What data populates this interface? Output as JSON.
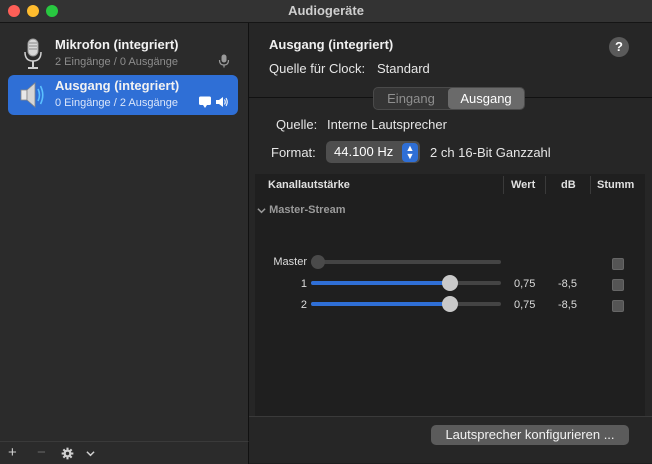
{
  "window": {
    "title": "Audiogeräte"
  },
  "sidebar": {
    "devices": [
      {
        "name": "Mikrofon (integriert)",
        "sub": "2 Eingänge / 0 Ausgänge",
        "icon": "microphone-icon",
        "badge_icon": "microphone-small-icon",
        "selected": false
      },
      {
        "name": "Ausgang (integriert)",
        "sub": "0 Eingänge / 2 Ausgänge",
        "icon": "speaker-icon",
        "badge_icon": "speaker-small-icon",
        "selected": true
      }
    ],
    "footer": {
      "add": "+",
      "remove": "−",
      "gear_icon": "gear-icon",
      "chevron_icon": "chevron-down-icon"
    }
  },
  "detail": {
    "title": "Ausgang (integriert)",
    "help": "?",
    "clock_label": "Quelle für Clock:",
    "clock_value": "Standard",
    "tabs": [
      "Eingang",
      "Ausgang"
    ],
    "active_tab": "Ausgang",
    "source_label": "Quelle:",
    "source_value": "Interne Lautsprecher",
    "format_label": "Format:",
    "format_value": "44.100 Hz",
    "format_extra": "2 ch 16-Bit Ganzzahl",
    "table": {
      "headers": [
        "Kanallautstärke",
        "Wert",
        "dB",
        "Stumm"
      ],
      "group": "Master-Stream",
      "rows": [
        {
          "label": "Master",
          "value": "",
          "db": "",
          "level": 0,
          "enabled": false
        },
        {
          "label": "1",
          "value": "0,75",
          "db": "-8,5",
          "level": 0.75,
          "enabled": true
        },
        {
          "label": "2",
          "value": "0,75",
          "db": "-8,5",
          "level": 0.75,
          "enabled": true
        }
      ]
    },
    "configure_button": "Lautsprecher konfigurieren ..."
  },
  "colors": {
    "accent": "#2f6fd6",
    "close": "#fe5f57",
    "minimize": "#febc2e",
    "maximize": "#28c840"
  }
}
